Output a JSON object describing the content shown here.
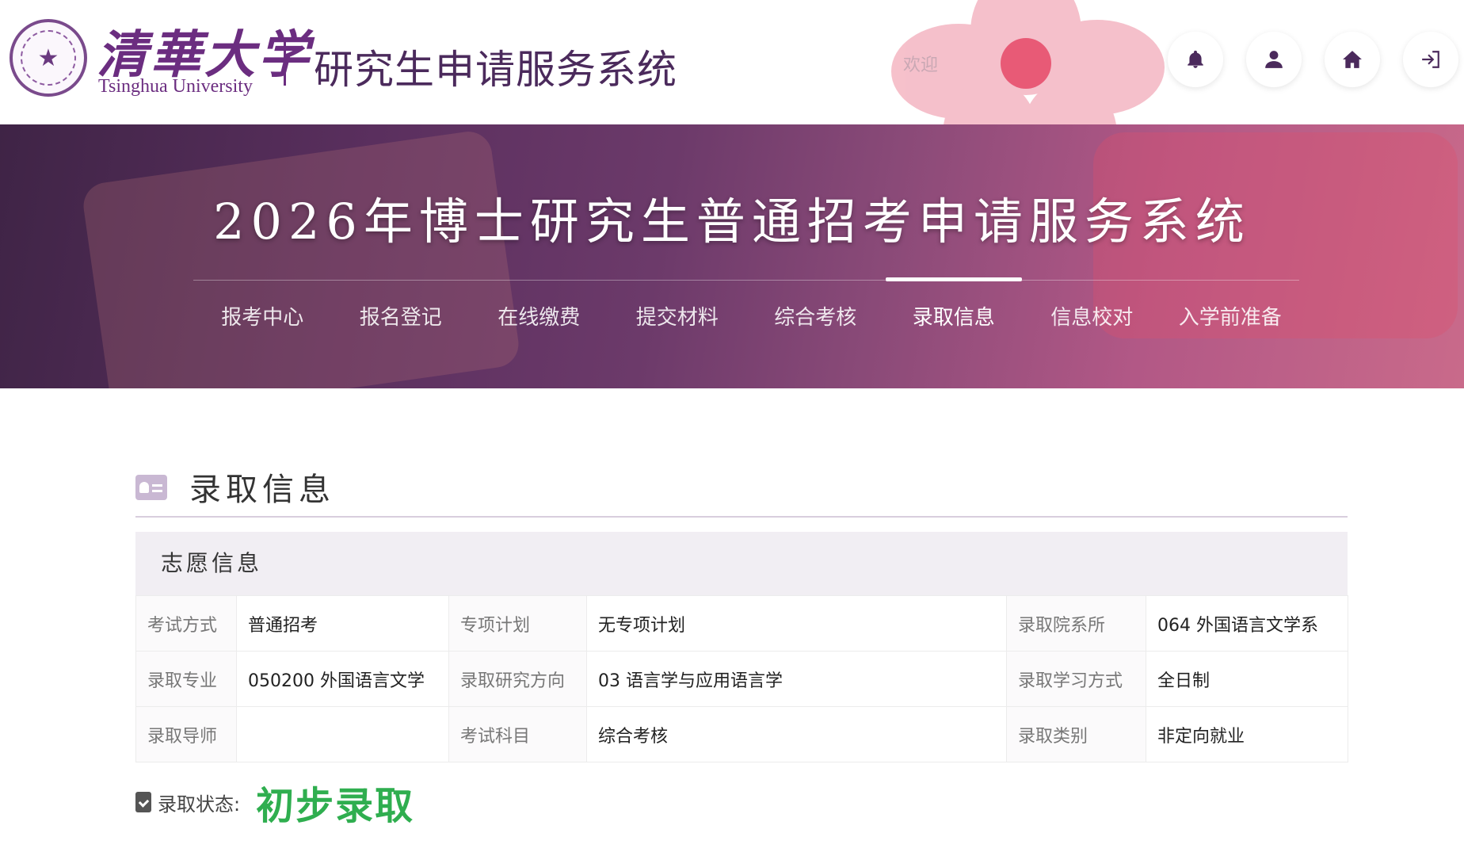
{
  "header": {
    "logo_cn": "清華大学",
    "logo_en": "Tsinghua University",
    "system_title": "研究生申请服务系统",
    "welcome": "欢迎",
    "icons": [
      "bell-icon",
      "user-icon",
      "home-icon",
      "logout-icon"
    ]
  },
  "banner": {
    "title": "2026年博士研究生普通招考申请服务系统",
    "nav": [
      {
        "label": "报考中心"
      },
      {
        "label": "报名登记"
      },
      {
        "label": "在线缴费"
      },
      {
        "label": "提交材料"
      },
      {
        "label": "综合考核"
      },
      {
        "label": "录取信息",
        "active": true
      },
      {
        "label": "信息校对"
      },
      {
        "label": "入学前准备"
      }
    ]
  },
  "section": {
    "title": "录取信息",
    "panel_title": "志愿信息",
    "rows": [
      [
        {
          "label": "考试方式",
          "value": "普通招考"
        },
        {
          "label": "专项计划",
          "value": "无专项计划"
        },
        {
          "label": "录取院系所",
          "value": "064 外国语言文学系"
        }
      ],
      [
        {
          "label": "录取专业",
          "value": "050200 外国语言文学"
        },
        {
          "label": "录取研究方向",
          "value": "03 语言学与应用语言学"
        },
        {
          "label": "录取学习方式",
          "value": "全日制"
        }
      ],
      [
        {
          "label": "录取导师",
          "value": ""
        },
        {
          "label": "考试科目",
          "value": "综合考核"
        },
        {
          "label": "录取类别",
          "value": "非定向就业"
        }
      ]
    ],
    "status_label": "录取状态:",
    "status_value": "初步录取"
  },
  "colors": {
    "brand_purple": "#6b2d80",
    "status_green": "#2fae4f"
  }
}
